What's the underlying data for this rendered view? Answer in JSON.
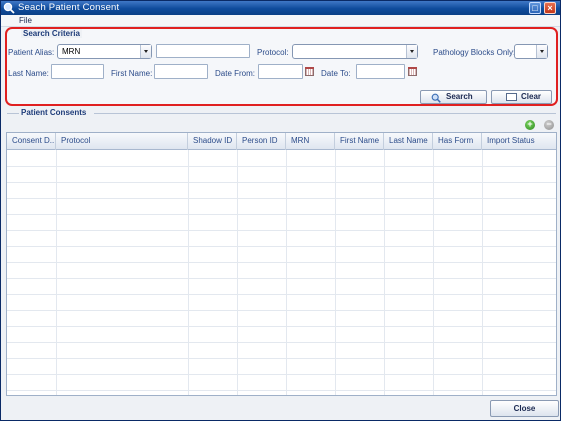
{
  "window": {
    "title": "Seach Patient Consent"
  },
  "menu": {
    "file": "File"
  },
  "search_criteria": {
    "legend": "Search Criteria",
    "patient_alias_label": "Patient Alias:",
    "patient_alias_value": "MRN",
    "patient_alias_text": "",
    "protocol_label": "Protocol:",
    "protocol_value": "",
    "pathology_label": "Pathology Blocks Only:",
    "pathology_value": "",
    "last_name_label": "Last Name:",
    "last_name_value": "",
    "first_name_label": "First Name:",
    "first_name_value": "",
    "date_from_label": "Date From:",
    "date_from_value": "",
    "date_to_label": "Date To:",
    "date_to_value": "",
    "search_button": "Search",
    "clear_button": "Clear"
  },
  "patient_consents": {
    "legend": "Patient Consents",
    "columns": [
      "Consent D...",
      "Protocol",
      "Shadow ID",
      "Person ID",
      "MRN",
      "First Name",
      "Last Name",
      "Has Form",
      "Import Status"
    ]
  },
  "footer": {
    "close_button": "Close"
  },
  "colors": {
    "title_bar": "#0f4b9c",
    "highlight_frame": "#e02020",
    "label": "#2c4c8a"
  }
}
